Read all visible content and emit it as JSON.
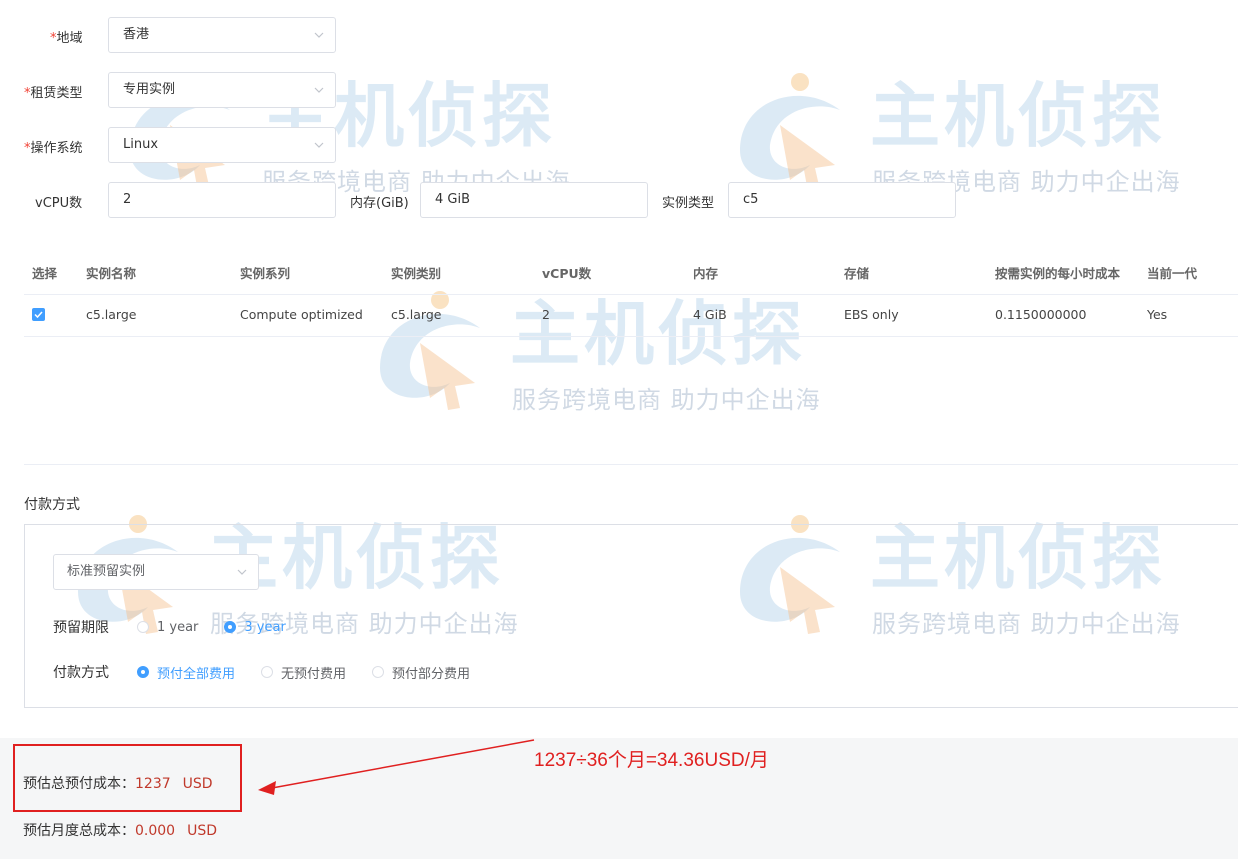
{
  "watermark": {
    "brand": "主机侦探",
    "slogan": "服务跨境电商 助力中企出海"
  },
  "form": {
    "region": {
      "label": "地域",
      "value": "香港"
    },
    "tenancy": {
      "label": "租赁类型",
      "value": "专用实例"
    },
    "os": {
      "label": "操作系统",
      "value": "Linux"
    },
    "vcpu": {
      "label": "vCPU数",
      "value": "2"
    },
    "memory": {
      "label": "内存(GiB)",
      "value": "4 GiB"
    },
    "instance_type": {
      "label": "实例类型",
      "value": "c5"
    }
  },
  "table": {
    "headers": [
      "选择",
      "实例名称",
      "实例系列",
      "实例类别",
      "vCPU数",
      "内存",
      "存储",
      "按需实例的每小时成本",
      "当前一代"
    ],
    "rows": [
      [
        "",
        "c5.large",
        "Compute optimized",
        "c5.large",
        "2",
        "4 GiB",
        "EBS only",
        "0.1150000000",
        "Yes"
      ]
    ]
  },
  "payment": {
    "section_title": "付款方式",
    "offering": "标准预留实例",
    "term_label": "预留期限",
    "terms": [
      "1 year",
      "3 year"
    ],
    "term_selected": "3 year",
    "method_label": "付款方式",
    "methods": [
      "预付全部费用",
      "无预付费用",
      "预付部分费用"
    ],
    "method_selected": "预付全部费用"
  },
  "costs": {
    "total_label": "预估总预付成本：",
    "total_value": "1237",
    "total_unit": "USD",
    "monthly_label": "预估月度总成本：",
    "monthly_value": "0.000",
    "monthly_unit": "USD"
  },
  "annotation": {
    "text": "1237÷36个月=34.36USD/月"
  },
  "colors": {
    "accent": "#409eff",
    "required": "#f04134",
    "annotation": "#e02020",
    "cost": "#c0392b"
  }
}
